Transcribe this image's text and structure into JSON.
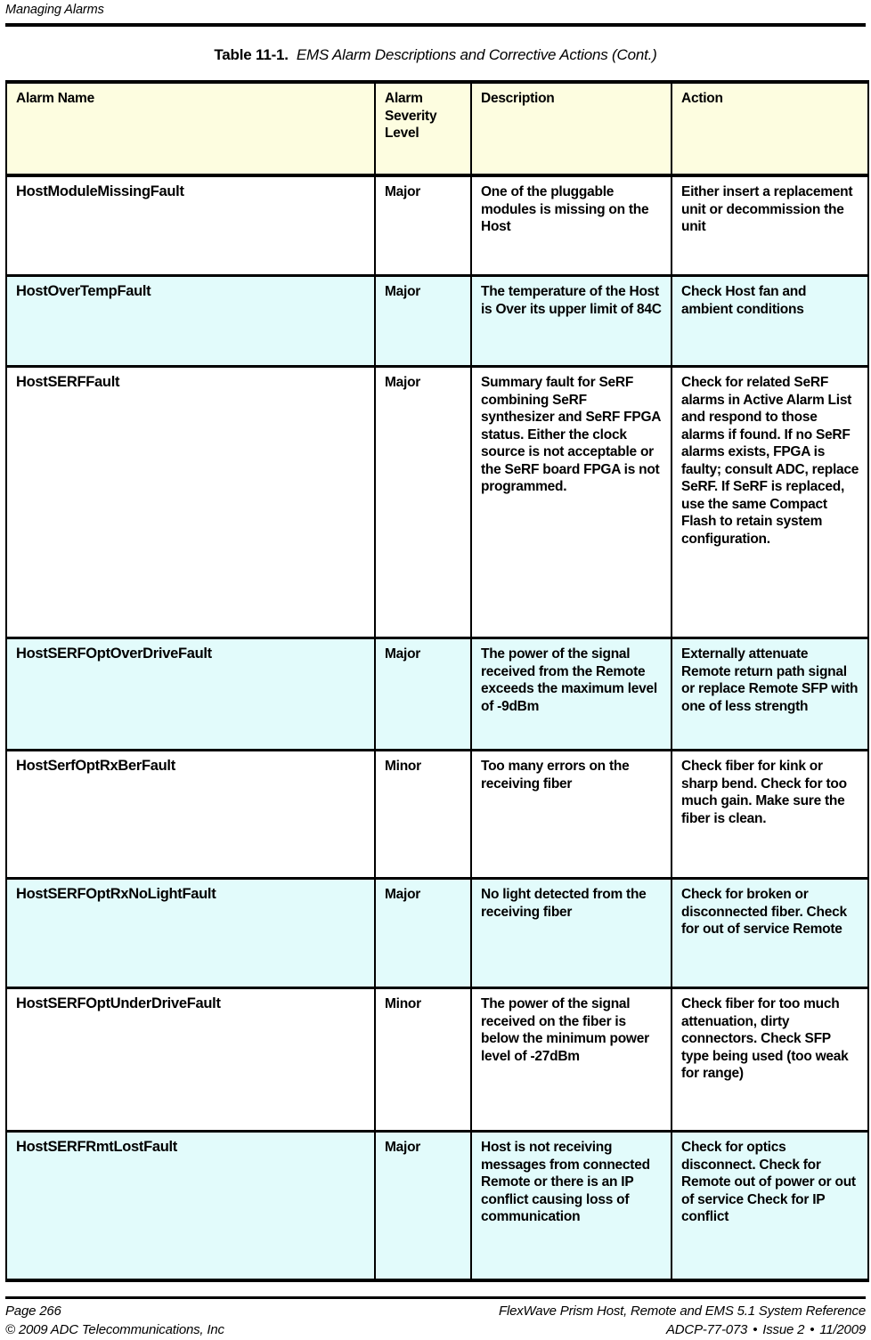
{
  "header": {
    "running_head": "Managing Alarms"
  },
  "caption": {
    "label": "Table 11-1.",
    "title": "EMS Alarm Descriptions and Corrective Actions (Cont.)"
  },
  "table": {
    "columns": [
      "Alarm Name",
      "Alarm Severity Level",
      "Description",
      "Action"
    ],
    "header_colors": {
      "background": "#FDFDE0"
    },
    "row_colors": {
      "shaded": "#E2FBFB",
      "plain": "#FFFFFF"
    },
    "rows": [
      {
        "alarm_name": "HostModuleMissingFault",
        "severity": "Major",
        "description": "One of the pluggable modules is missing on the Host",
        "action": "Either insert a replacement unit or decommission the unit",
        "shaded": false
      },
      {
        "alarm_name": "HostOverTempFault",
        "severity": "Major",
        "description": "The temperature of the Host is Over its upper limit of 84C",
        "action": "Check Host fan and ambient conditions",
        "shaded": true
      },
      {
        "alarm_name": "HostSERFFault",
        "severity": "Major",
        "description": "Summary fault for SeRF combining SeRF synthesizer and SeRF FPGA status. Either the clock source is not acceptable or the SeRF board FPGA is not programmed.",
        "action": "Check for related SeRF alarms in Active Alarm List and respond to those alarms if found. If no SeRF alarms exists, FPGA is faulty; consult ADC, replace SeRF. If SeRF is replaced, use the same Compact Flash to retain system configuration.",
        "shaded": false
      },
      {
        "alarm_name": "HostSERFOptOverDriveFault",
        "severity": "Major",
        "description": "The power of the signal received from the Remote exceeds the maximum level of -9dBm",
        "action": "Externally attenuate Remote return path signal or replace Remote SFP with one of less strength",
        "shaded": true
      },
      {
        "alarm_name": "HostSerfOptRxBerFault",
        "severity": "Minor",
        "description": "Too many errors on the receiving fiber",
        "action": "Check fiber for kink or sharp bend. Check for too much gain. Make sure the fiber is clean.",
        "shaded": false
      },
      {
        "alarm_name": "HostSERFOptRxNoLightFault",
        "severity": "Major",
        "description": "No light detected from the receiving fiber",
        "action": "Check for broken or disconnected fiber. Check for out of service Remote",
        "shaded": true
      },
      {
        "alarm_name": "HostSERFOptUnderDriveFault",
        "severity": "Minor",
        "description": "The power of the signal received on the fiber is below the minimum power level of -27dBm",
        "action": "Check fiber for too much attenuation, dirty connectors. Check SFP type being used (too weak for range)",
        "shaded": false
      },
      {
        "alarm_name": "HostSERFRmtLostFault",
        "severity": "Major",
        "description": "Host is not receiving messages from connected Remote or there is an IP conflict causing loss of communication",
        "action": "Check for optics disconnect. Check for Remote out of power or out of service Check for IP conflict",
        "shaded": true
      }
    ]
  },
  "footer": {
    "page_number": "Page 266",
    "copyright": "© 2009 ADC Telecommunications, Inc",
    "document_title": "FlexWave Prism Host, Remote and EMS 5.1 System Reference",
    "doc_number": "ADCP-77-073",
    "issue": "Issue 2",
    "date": "11/2009",
    "separator": "•"
  }
}
